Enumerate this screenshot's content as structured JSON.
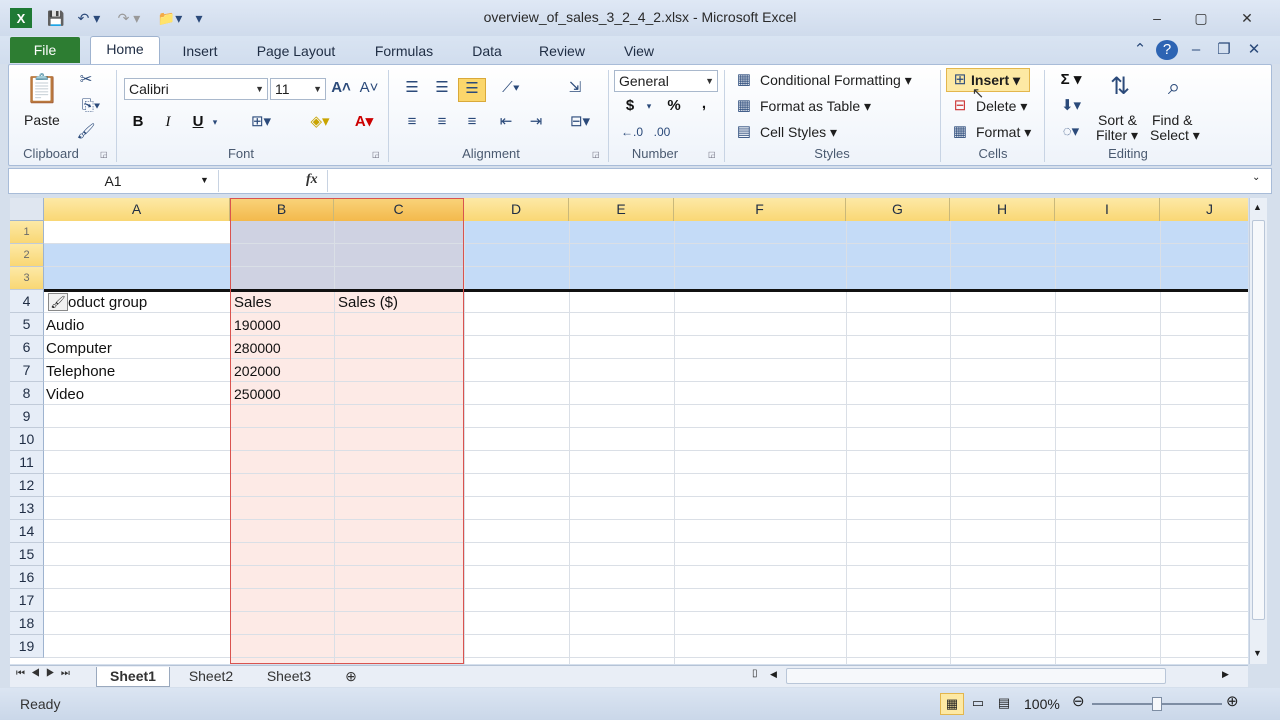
{
  "window": {
    "title": "overview_of_sales_3_2_4_2.xlsx - Microsoft Excel"
  },
  "tabs": [
    "File",
    "Home",
    "Insert",
    "Page Layout",
    "Formulas",
    "Data",
    "Review",
    "View"
  ],
  "ribbon": {
    "clipboard": {
      "paste": "Paste",
      "label": "Clipboard"
    },
    "font": {
      "name": "Calibri",
      "size": "11",
      "label": "Font",
      "bold": "B",
      "italic": "I",
      "underline": "U"
    },
    "alignment": {
      "label": "Alignment"
    },
    "number": {
      "format": "General",
      "currency": "$",
      "percent": "%",
      "comma": ",",
      "label": "Number"
    },
    "styles": {
      "conditional": "Conditional Formatting",
      "format_table": "Format as Table",
      "cell_styles": "Cell Styles",
      "label": "Styles"
    },
    "cells": {
      "insert": "Insert",
      "delete": "Delete",
      "format": "Format",
      "label": "Cells"
    },
    "editing": {
      "sort": "Sort &",
      "filter": "Filter",
      "find": "Find &",
      "select": "Select",
      "label": "Editing",
      "sigma": "Σ"
    }
  },
  "formula_bar": {
    "name_box": "A1",
    "fx": "fx",
    "value": ""
  },
  "columns": [
    "A",
    "B",
    "C",
    "D",
    "E",
    "F",
    "G",
    "H",
    "I",
    "J"
  ],
  "rows": [
    "1",
    "2",
    "3",
    "4",
    "5",
    "6",
    "7",
    "8",
    "9",
    "10",
    "11",
    "12",
    "13",
    "14",
    "15",
    "16",
    "17",
    "18",
    "19"
  ],
  "cells": {
    "A4": "oduct group",
    "B4": "Sales",
    "C4": "Sales ($)",
    "A5": "Audio",
    "B5": "190000",
    "A6": "Computer",
    "B6": "280000",
    "A7": "Telephone",
    "B7": "202000",
    "A8": "Video",
    "B8": "250000"
  },
  "sheets": [
    "Sheet1",
    "Sheet2",
    "Sheet3"
  ],
  "status": {
    "ready": "Ready",
    "zoom": "100%"
  }
}
